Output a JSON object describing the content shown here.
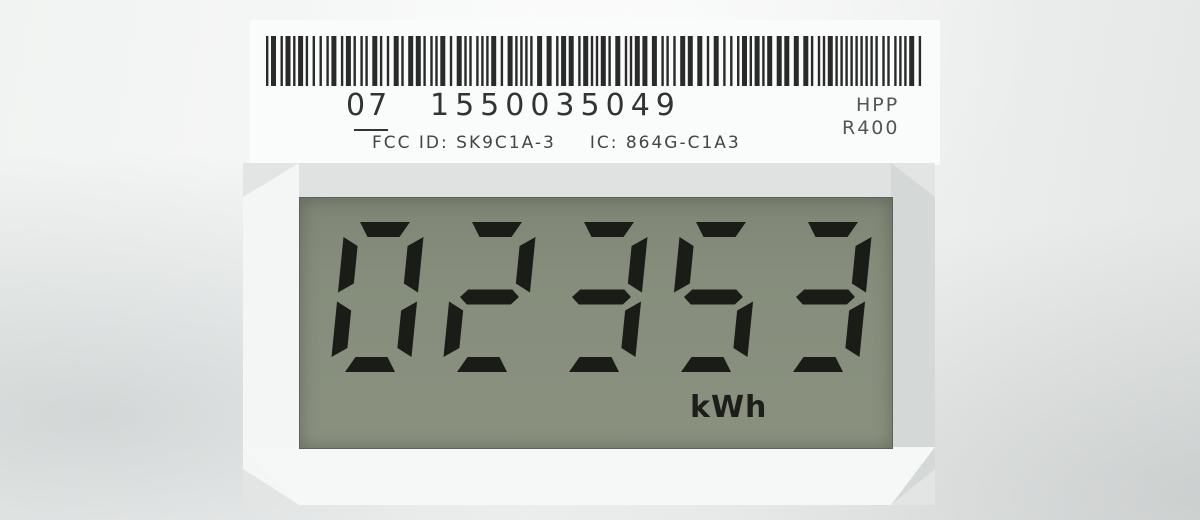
{
  "label": {
    "serial_prefix": "07",
    "serial_number": "1550035049",
    "model_line1": "HPP",
    "model_line2": "R400",
    "fcc_id": "FCC ID: SK9C1A-3",
    "ic_id": "IC: 864G-C1A3"
  },
  "display": {
    "reading": "02353",
    "unit": "kWh"
  },
  "colors": {
    "lcd_background": "#868d7c",
    "segment": "#1a1c18",
    "meter_body": "#f1f3f2"
  }
}
